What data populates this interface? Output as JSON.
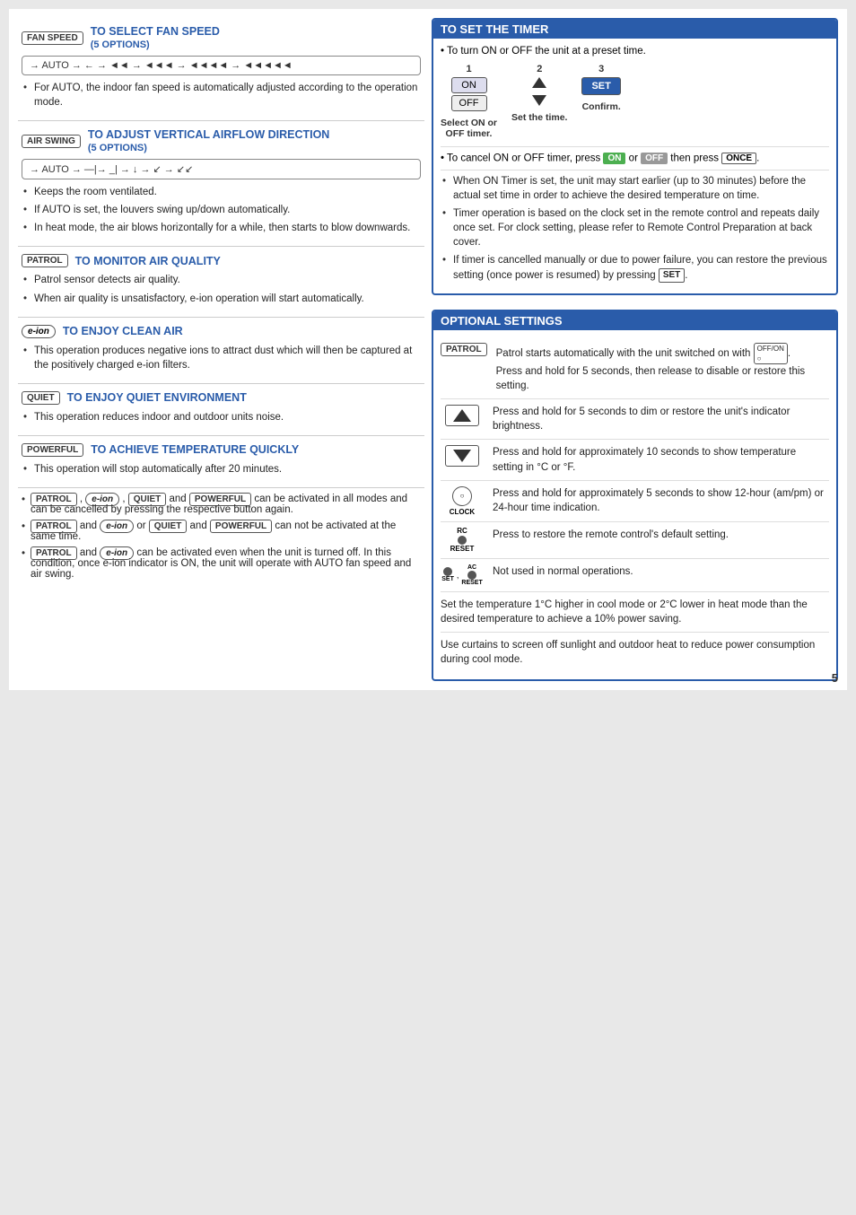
{
  "page": {
    "number": "5",
    "left": {
      "sections": [
        {
          "id": "fan-speed",
          "badge": "FAN SPEED",
          "title": "TO SELECT FAN SPEED",
          "subtitle": "(5 OPTIONS)",
          "diagram_label": "→ AUTO → ← → ◄◄ → ◄◄◄ → ◄◄◄◄",
          "bullets": [
            "For AUTO, the indoor fan speed is automatically adjusted according to the operation mode."
          ]
        },
        {
          "id": "air-swing",
          "badge": "AIR SWING",
          "title": "TO ADJUST VERTICAL AIRFLOW DIRECTION",
          "subtitle": "(5 OPTIONS)",
          "bullets": [
            "Keeps the room ventilated.",
            "If AUTO is set, the louvers swing up/down automatically.",
            "In heat mode, the air blows horizontally for a while, then starts to blow downwards."
          ]
        },
        {
          "id": "patrol",
          "badge": "PATROL",
          "title": "TO MONITOR AIR QUALITY",
          "bullets": [
            "Patrol sensor detects air quality.",
            "When air quality is unsatisfactory, e-ion operation will start automatically."
          ]
        },
        {
          "id": "eion",
          "badge": "e-ion",
          "title": "TO ENJOY CLEAN AIR",
          "bullets": [
            "This operation produces negative ions to attract dust which will then be captured at the positively charged e-ion filters."
          ]
        },
        {
          "id": "quiet",
          "badge": "QUIET",
          "title": "TO ENJOY QUIET ENVIRONMENT",
          "bullets": [
            "This operation reduces indoor and outdoor units noise."
          ]
        },
        {
          "id": "powerful",
          "badge": "POWERFUL",
          "title": "TO ACHIEVE TEMPERATURE QUICKLY",
          "bullets": [
            "This operation will stop automatically after 20 minutes."
          ]
        }
      ],
      "bottom_bullets": [
        {
          "badges": [
            "PATROL",
            "e-ion",
            "QUIET",
            "POWERFUL"
          ],
          "text": "can be activated in all modes and can be cancelled by pressing the respective button again."
        },
        {
          "badges": [
            "PATROL",
            "e-ion",
            "QUIET",
            "POWERFUL"
          ],
          "connector": "and ... or ... and ... can not",
          "text": "PATROL and e-ion or QUIET and POWERFUL can not be activated at the same time."
        },
        {
          "badges": [
            "PATROL",
            "e-ion"
          ],
          "text": "can be activated even when the unit is turned off. In this condition, once e-ion indicator is ON, the unit will operate with AUTO fan speed and air swing."
        }
      ]
    },
    "right": {
      "timer": {
        "title": "TO SET THE TIMER",
        "intro": "To turn ON or OFF the unit at a preset time.",
        "steps": [
          {
            "number": "1",
            "buttons": [
              "ON",
              "OFF"
            ],
            "label": "Select ON or\nOFF timer."
          },
          {
            "number": "2",
            "label": "Set the time."
          },
          {
            "number": "3",
            "button": "SET",
            "label": "Confirm."
          }
        ],
        "cancel_note": "To cancel ON or OFF timer, press",
        "cancel_btns": [
          "ON",
          "OFF"
        ],
        "cancel_then": "then press",
        "cancel_last": "ONCE",
        "bullets": [
          "When ON Timer is set, the unit may start earlier (up to 30 minutes) before the actual set time in order to achieve the desired temperature on time.",
          "Timer operation is based on the clock set in the remote control and repeats daily once set. For clock setting, please refer to Remote Control Preparation at back cover.",
          "If timer is cancelled manually or due to power failure, you can restore the previous setting (once power is resumed) by pressing SET."
        ]
      },
      "optional": {
        "title": "OPTIONAL SETTINGS",
        "rows": [
          {
            "icon_type": "patrol-badge",
            "text": "Patrol starts automatically with the unit switched on with OFF/ON button. Press and hold for 5 seconds, then release to disable or restore this setting."
          },
          {
            "icon_type": "tri-up",
            "text": "Press and hold for 5 seconds to dim or restore the unit's indicator brightness."
          },
          {
            "icon_type": "tri-down",
            "text": "Press and hold for approximately 10 seconds to show temperature setting in °C or °F."
          },
          {
            "icon_type": "clock",
            "text": "Press and hold for approximately 5 seconds to show 12-hour (am/pm) or 24-hour time indication."
          },
          {
            "icon_type": "rc-reset",
            "text": "Press to restore the remote control's default setting."
          },
          {
            "icon_type": "set-reset",
            "text": "Not used in normal operations."
          }
        ],
        "bottom_notes": [
          "Set the temperature 1°C higher in cool mode or 2°C lower in heat mode than the desired temperature to achieve a 10% power saving.",
          "Use curtains to screen off sunlight and outdoor heat to reduce power consumption during cool mode."
        ]
      }
    }
  }
}
